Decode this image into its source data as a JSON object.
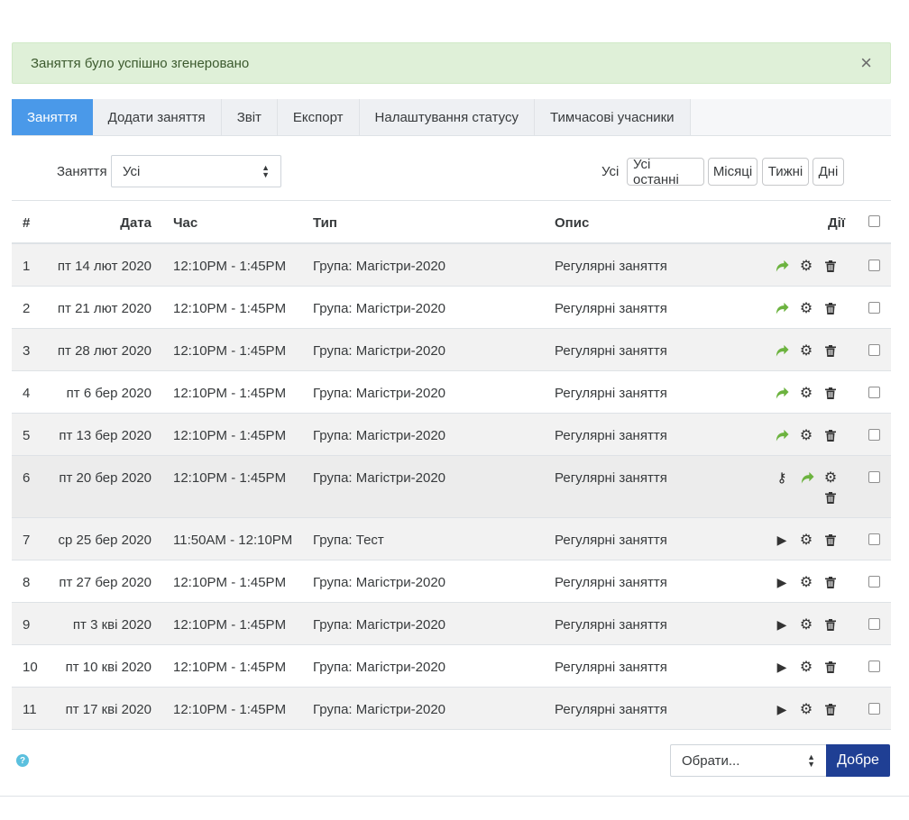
{
  "alert": {
    "message": "Заняття було успішно згенеровано",
    "close": "×"
  },
  "tabs": [
    {
      "label": "Заняття",
      "active": true
    },
    {
      "label": "Додати заняття",
      "active": false
    },
    {
      "label": "Звіт",
      "active": false
    },
    {
      "label": "Експорт",
      "active": false
    },
    {
      "label": "Налаштування статусу",
      "active": false
    },
    {
      "label": "Тимчасові учасники",
      "active": false
    }
  ],
  "filter": {
    "label": "Заняття",
    "selected": "Усі",
    "view_label": "Усі",
    "view_buttons": [
      "Усі останні",
      "Місяці",
      "Тижні",
      "Дні"
    ]
  },
  "table": {
    "headers": {
      "num": "#",
      "date": "Дата",
      "time": "Час",
      "type": "Тип",
      "desc": "Опис",
      "actions": "Дії"
    },
    "rows": [
      {
        "num": "1",
        "date": "пт 14 лют 2020",
        "time": "12:10PM - 1:45PM",
        "type": "Група: Магістри-2020",
        "desc": "Регулярні заняття",
        "icons": [
          "go-icon",
          "gear-icon",
          "trash-icon"
        ]
      },
      {
        "num": "2",
        "date": "пт 21 лют 2020",
        "time": "12:10PM - 1:45PM",
        "type": "Група: Магістри-2020",
        "desc": "Регулярні заняття",
        "icons": [
          "go-icon",
          "gear-icon",
          "trash-icon"
        ]
      },
      {
        "num": "3",
        "date": "пт 28 лют 2020",
        "time": "12:10PM - 1:45PM",
        "type": "Група: Магістри-2020",
        "desc": "Регулярні заняття",
        "icons": [
          "go-icon",
          "gear-icon",
          "trash-icon"
        ]
      },
      {
        "num": "4",
        "date": "пт 6 бер 2020",
        "time": "12:10PM - 1:45PM",
        "type": "Група: Магістри-2020",
        "desc": "Регулярні заняття",
        "icons": [
          "go-icon",
          "gear-icon",
          "trash-icon"
        ]
      },
      {
        "num": "5",
        "date": "пт 13 бер 2020",
        "time": "12:10PM - 1:45PM",
        "type": "Група: Магістри-2020",
        "desc": "Регулярні заняття",
        "icons": [
          "go-icon",
          "gear-icon",
          "trash-icon"
        ]
      },
      {
        "num": "6",
        "date": "пт 20 бер 2020",
        "time": "12:10PM - 1:45PM",
        "type": "Група: Магістри-2020",
        "desc": "Регулярні заняття",
        "icons": [
          "key-icon",
          "go-icon",
          "gear-icon",
          "trash-icon"
        ]
      },
      {
        "num": "7",
        "date": "ср 25 бер 2020",
        "time": "11:50AM - 12:10PM",
        "type": "Група: Тест",
        "desc": "Регулярні заняття",
        "icons": [
          "play-icon",
          "gear-icon",
          "trash-icon"
        ]
      },
      {
        "num": "8",
        "date": "пт 27 бер 2020",
        "time": "12:10PM - 1:45PM",
        "type": "Група: Магістри-2020",
        "desc": "Регулярні заняття",
        "icons": [
          "play-icon",
          "gear-icon",
          "trash-icon"
        ]
      },
      {
        "num": "9",
        "date": "пт 3 кві 2020",
        "time": "12:10PM - 1:45PM",
        "type": "Група: Магістри-2020",
        "desc": "Регулярні заняття",
        "icons": [
          "play-icon",
          "gear-icon",
          "trash-icon"
        ]
      },
      {
        "num": "10",
        "date": "пт 10 кві 2020",
        "time": "12:10PM - 1:45PM",
        "type": "Група: Магістри-2020",
        "desc": "Регулярні заняття",
        "icons": [
          "play-icon",
          "gear-icon",
          "trash-icon"
        ]
      },
      {
        "num": "11",
        "date": "пт 17 кві 2020",
        "time": "12:10PM - 1:45PM",
        "type": "Група: Магістри-2020",
        "desc": "Регулярні заняття",
        "icons": [
          "play-icon",
          "gear-icon",
          "trash-icon"
        ]
      }
    ]
  },
  "bulk": {
    "select_value": "Обрати...",
    "submit": "Добре",
    "help_icon": "question-circle-icon"
  },
  "colors": {
    "accent": "#4a99e9",
    "alert_bg": "#dff0d8",
    "go_green": "#6cb33f",
    "submit_bg": "#1f3f94"
  }
}
